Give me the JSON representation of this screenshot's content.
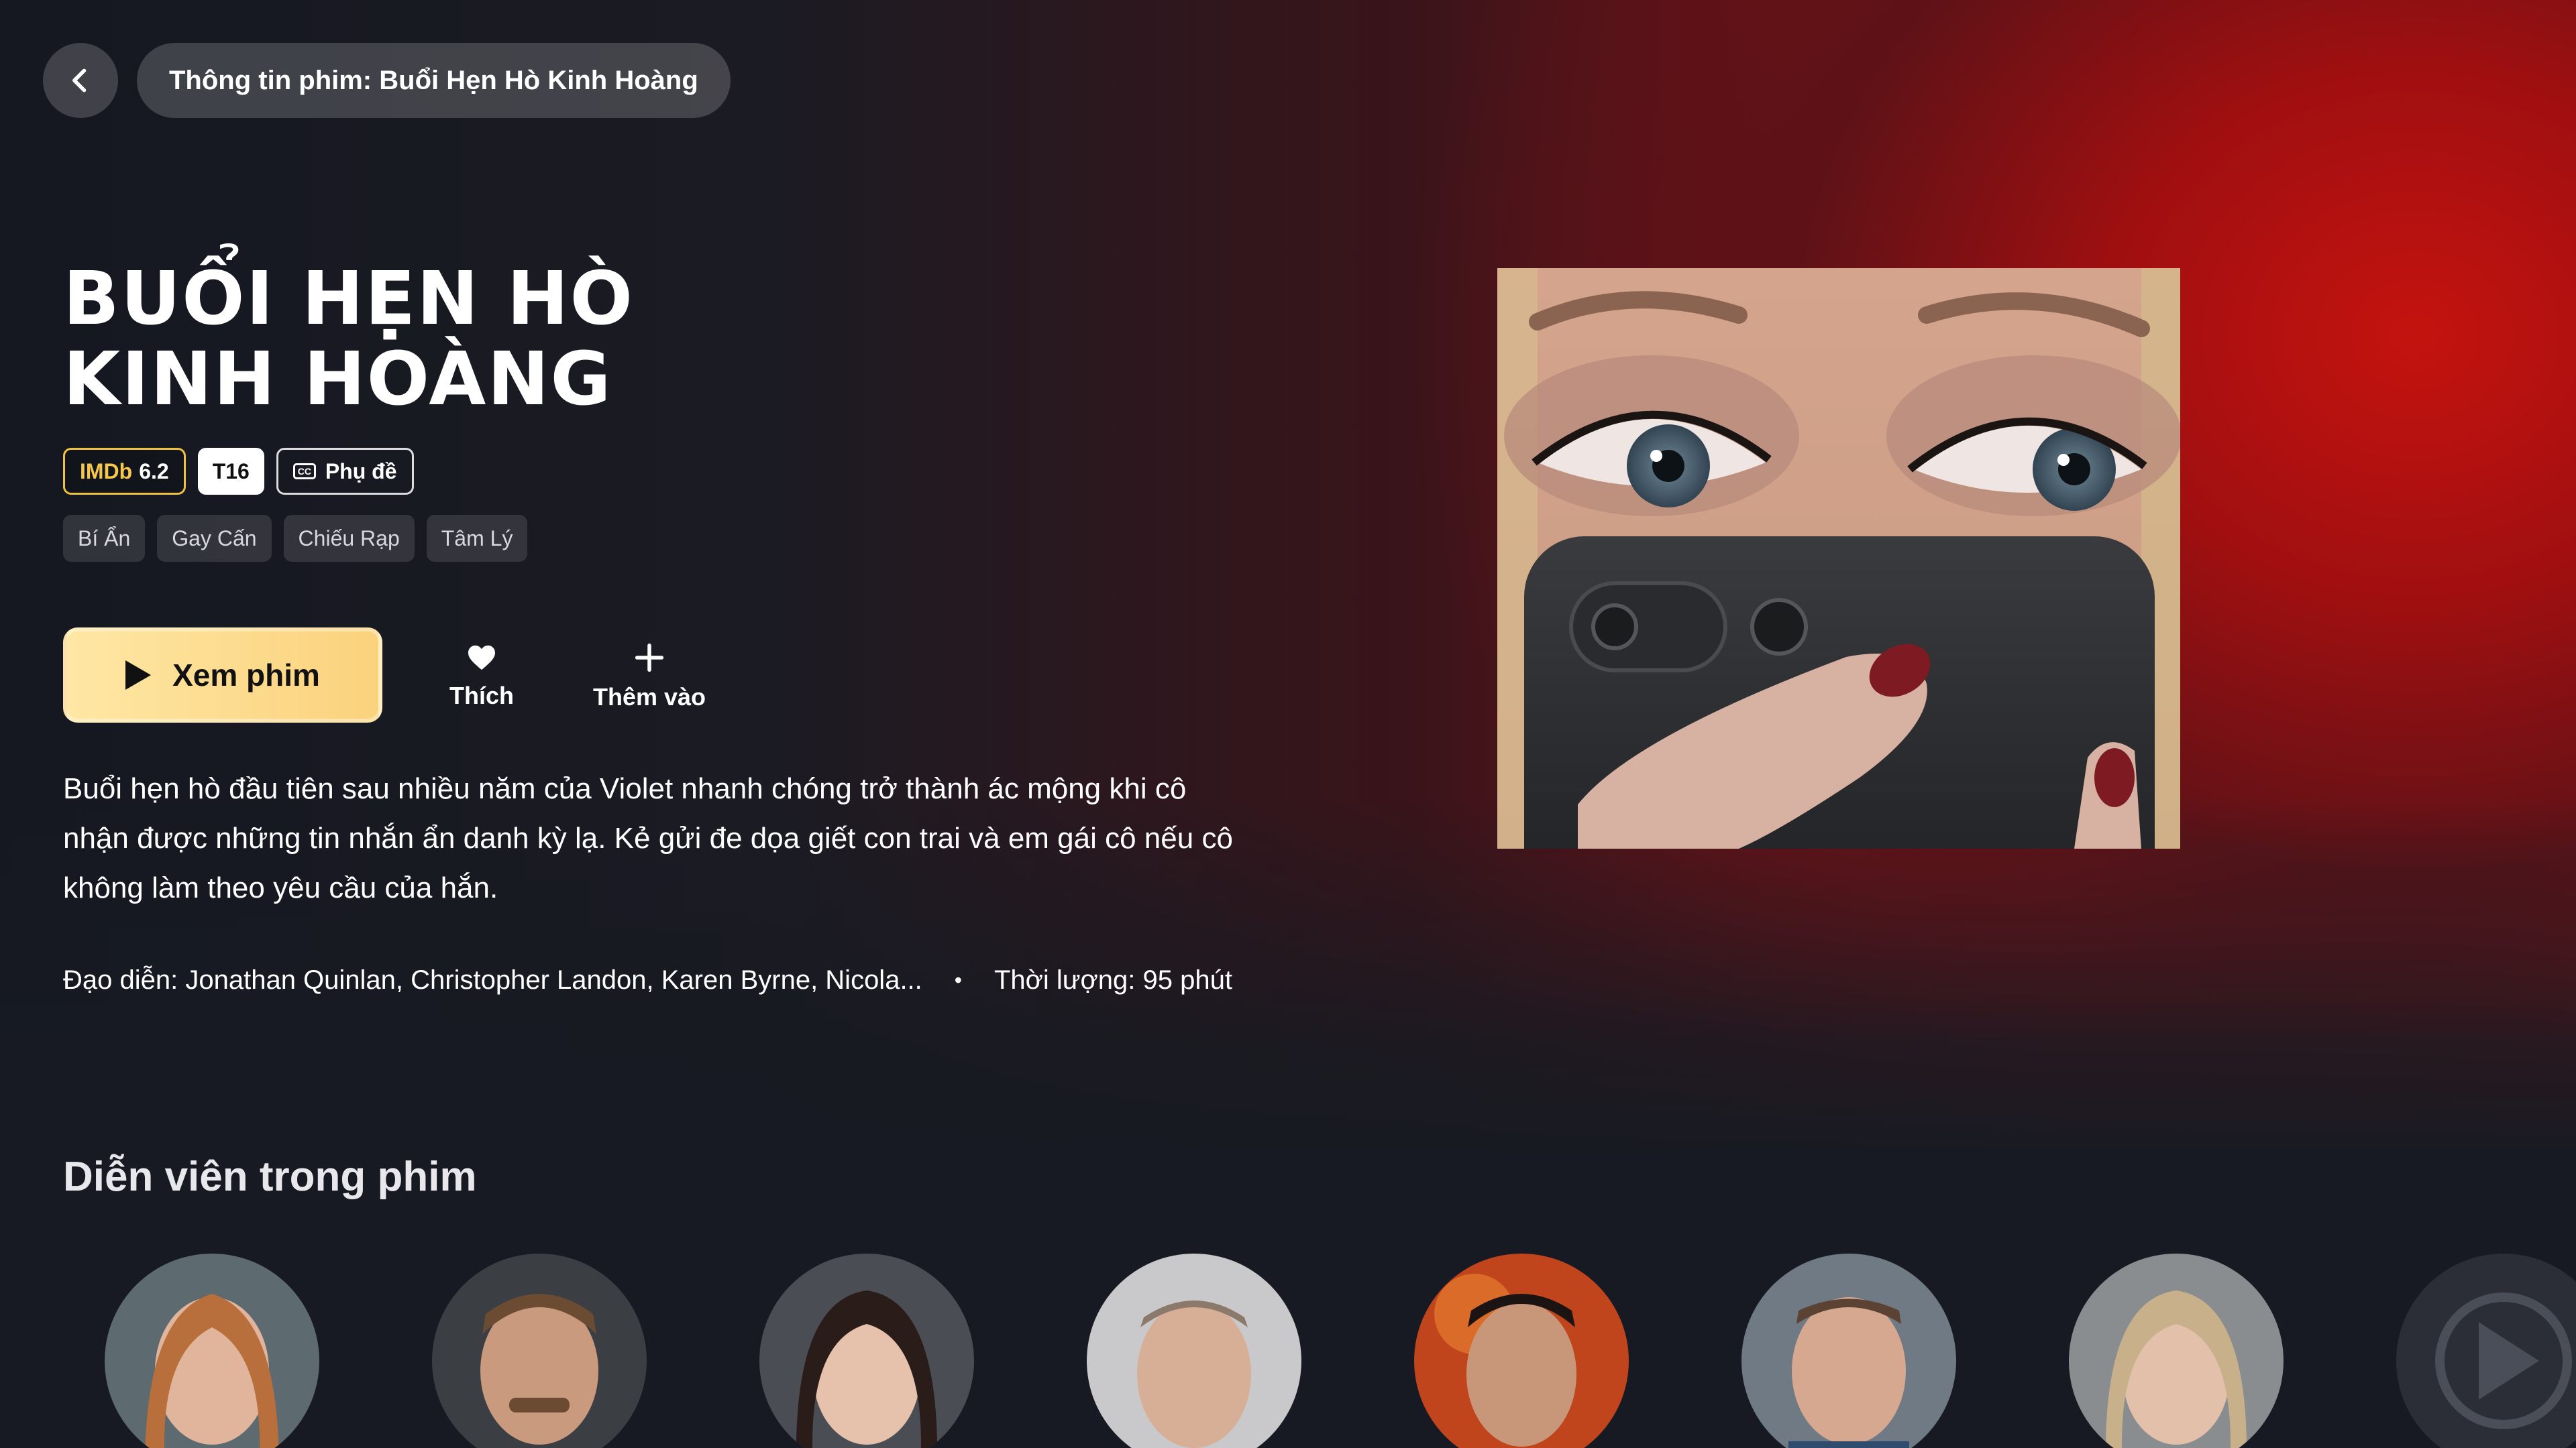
{
  "header": {
    "breadcrumb": "Thông tin phim: Buổi Hẹn Hò Kinh Hoàng"
  },
  "movie": {
    "title_line1": "BUỔI HẸN HÒ",
    "title_line2": "KINH HOÀNG",
    "imdb_label": "IMDb",
    "imdb_score": "6.2",
    "age_rating": "T16",
    "cc_icon": "CC",
    "subtitle_label": "Phụ đề",
    "genres": [
      "Bí Ẩn",
      "Gay Cấn",
      "Chiếu Rạp",
      "Tâm Lý"
    ],
    "description": "Buổi hẹn hò đầu tiên sau nhiều năm của Violet nhanh chóng trở thành ác mộng khi cô nhận được những tin nhắn ẩn danh kỳ lạ. Kẻ gửi đe dọa giết con trai và em gái cô nếu cô không làm theo yêu cầu của hắn.",
    "director": "Đạo diễn: Jonathan Quinlan, Christopher Landon, Karen Byrne, Nicola...",
    "separator": "•",
    "duration": "Thời lượng: 95 phút"
  },
  "actions": {
    "play_label": "Xem phim",
    "like_label": "Thích",
    "add_label": "Thêm vào"
  },
  "cast": {
    "title": "Diễn viên trong phim"
  },
  "colors": {
    "accent_yellow": "#fbd27d",
    "imdb_yellow": "#f5c84c",
    "hero_red": "#c4130f",
    "background": "#171a22"
  },
  "icons": {
    "back": "chevron-left-icon",
    "play": "play-icon",
    "like": "heart-icon",
    "add": "plus-icon",
    "subtitle": "cc-icon",
    "brand": "play-logo-icon"
  }
}
